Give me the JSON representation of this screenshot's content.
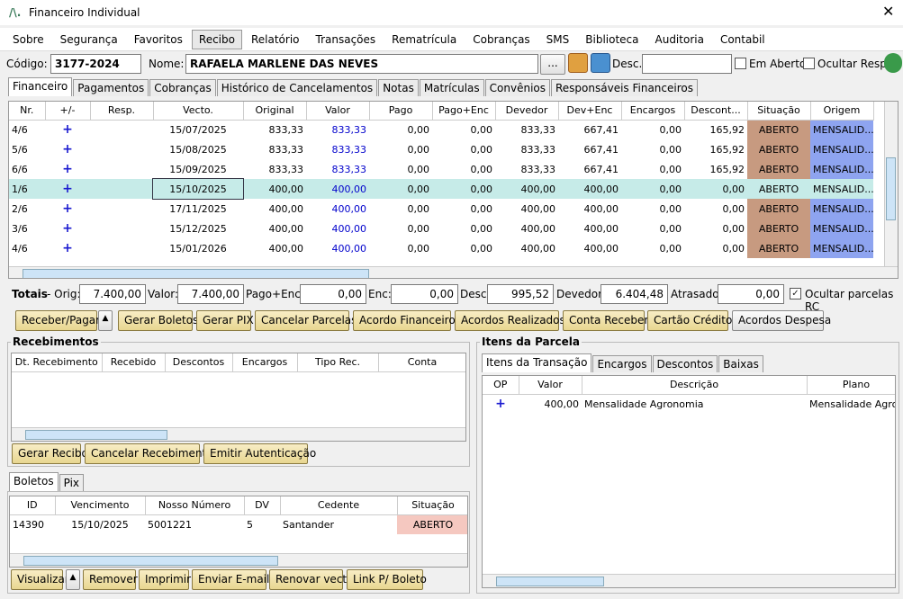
{
  "window": {
    "title": "Financeiro Individual",
    "close": "✕",
    "logo": "/\\."
  },
  "menu": [
    "Sobre",
    "Segurança",
    "Favoritos",
    "Recibo",
    "Relatório",
    "Transações",
    "Rematrícula",
    "Cobranças",
    "SMS",
    "Biblioteca",
    "Auditoria",
    "Contabil"
  ],
  "student": {
    "code_label": "Código:",
    "code": "3177-2024",
    "name_label": "Nome:",
    "name": "RAFAELA MARLENE DAS NEVES",
    "ellipsis": "...",
    "desc_label": "Desc.:",
    "desc": "",
    "em_aberto": "Em Aberto",
    "ocultar_resp": "Ocultar Resp."
  },
  "tabs": [
    "Financeiro",
    "Pagamentos",
    "Cobranças",
    "Histórico de Cancelamentos",
    "Notas",
    "Matrículas",
    "Convênios",
    "Responsáveis Financeiros"
  ],
  "installments": {
    "headers": [
      "Nr.",
      "+/-",
      "Resp.",
      "Vecto.",
      "Original",
      "Valor",
      "Pago",
      "Pago+Enc",
      "Devedor",
      "Dev+Enc",
      "Encargos",
      "Descont...",
      "Situação",
      "Origem"
    ],
    "rows": [
      [
        "4/6",
        "+",
        "",
        "15/07/2025",
        "833,33",
        "833,33",
        "0,00",
        "0,00",
        "833,33",
        "667,41",
        "0,00",
        "165,92",
        "ABERTO",
        "MENSALID..."
      ],
      [
        "5/6",
        "+",
        "",
        "15/08/2025",
        "833,33",
        "833,33",
        "0,00",
        "0,00",
        "833,33",
        "667,41",
        "0,00",
        "165,92",
        "ABERTO",
        "MENSALID..."
      ],
      [
        "6/6",
        "+",
        "",
        "15/09/2025",
        "833,33",
        "833,33",
        "0,00",
        "0,00",
        "833,33",
        "667,41",
        "0,00",
        "165,92",
        "ABERTO",
        "MENSALID..."
      ],
      [
        "1/6",
        "+",
        "",
        "15/10/2025",
        "400,00",
        "400,00",
        "0,00",
        "0,00",
        "400,00",
        "400,00",
        "0,00",
        "0,00",
        "ABERTO",
        "MENSALID..."
      ],
      [
        "2/6",
        "+",
        "",
        "17/11/2025",
        "400,00",
        "400,00",
        "0,00",
        "0,00",
        "400,00",
        "400,00",
        "0,00",
        "0,00",
        "ABERTO",
        "MENSALID..."
      ],
      [
        "3/6",
        "+",
        "",
        "15/12/2025",
        "400,00",
        "400,00",
        "0,00",
        "0,00",
        "400,00",
        "400,00",
        "0,00",
        "0,00",
        "ABERTO",
        "MENSALID..."
      ],
      [
        "4/6",
        "+",
        "",
        "15/01/2026",
        "400,00",
        "400,00",
        "0,00",
        "0,00",
        "400,00",
        "400,00",
        "0,00",
        "0,00",
        "ABERTO",
        "MENSALID..."
      ]
    ],
    "selected_row": 3
  },
  "totals": {
    "label": "Totais",
    "orig_label": "- Orig:",
    "orig": "7.400,00",
    "valor_label": "Valor:",
    "valor": "7.400,00",
    "pagoenc_label": "Pago+Enc:",
    "pagoenc": "0,00",
    "enc_label": "Enc:",
    "enc": "0,00",
    "desc_label": "Desc:",
    "desc": "995,52",
    "devedor_label": "Devedor:",
    "devedor": "6.404,48",
    "atrasado_label": "Atrasado:",
    "atrasado": "0,00",
    "ocultar_label": "Ocultar parcelas RC"
  },
  "actions": [
    "Receber/Pagar",
    "Gerar Boletos",
    "Gerar PIX",
    "Cancelar Parcelas",
    "Acordo Financeiro",
    "Acordos Realizados",
    "Conta Receber",
    "Cartão Crédito",
    "Acordos Despesa"
  ],
  "receipts": {
    "title": "Recebimentos",
    "headers": [
      "Dt. Recebimento",
      "Recebido",
      "Descontos",
      "Encargos",
      "Tipo Rec.",
      "Conta"
    ],
    "buttons": [
      "Gerar Recibo",
      "Cancelar Recebimento",
      "Emitir Autenticação"
    ]
  },
  "boletos": {
    "tabs": [
      "Boletos",
      "Pix"
    ],
    "headers": [
      "ID",
      "Vencimento",
      "Nosso Número",
      "DV",
      "Cedente",
      "Situação"
    ],
    "rows": [
      [
        "14390",
        "15/10/2025",
        "5001221",
        "5",
        "Santander",
        "ABERTO"
      ]
    ],
    "buttons": [
      "Visualizar",
      "Remover",
      "Imprimir",
      "Enviar E-mail",
      "Renovar vecto",
      "Link P/ Boleto"
    ]
  },
  "items": {
    "title": "Itens da Parcela",
    "tabs": [
      "Itens da Transação",
      "Encargos",
      "Descontos",
      "Baixas"
    ],
    "headers": [
      "OP",
      "Valor",
      "Descrição",
      "Plano"
    ],
    "rows": [
      [
        "+",
        "400,00",
        "Mensalidade Agronomia",
        "Mensalidade Agro"
      ]
    ]
  }
}
